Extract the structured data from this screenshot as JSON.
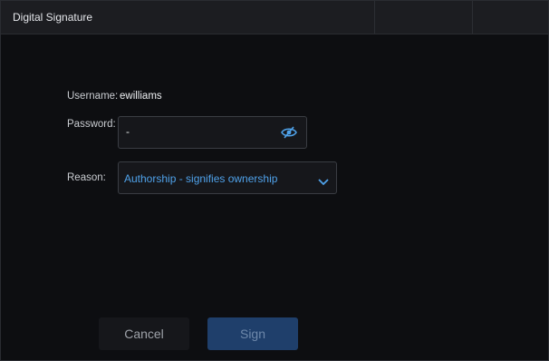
{
  "dialog": {
    "title": "Digital Signature"
  },
  "form": {
    "username_label": "Username:",
    "username_value": "ewilliams",
    "password_label": "Password:",
    "password_value": "-",
    "reason_label": "Reason:",
    "reason_selected": "Authorship - signifies ownership"
  },
  "buttons": {
    "cancel_label": "Cancel",
    "sign_label": "Sign"
  },
  "colors": {
    "accent": "#4fa2ea",
    "sign_button_bg": "#1f3f6b",
    "background": "#0d0e11"
  },
  "icons": {
    "password_toggle": "eye-slash-icon",
    "reason_dropdown": "chevron-down-icon"
  }
}
